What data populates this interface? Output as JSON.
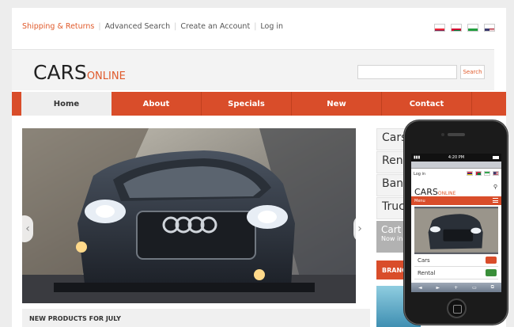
{
  "toplinks": {
    "shipping": "Shipping & Returns",
    "advanced_search": "Advanced Search",
    "create_account": "Create an Account",
    "login": "Log in"
  },
  "flags": [
    "mauritius-flag",
    "maldives-flag",
    "iran-flag",
    "usa-flag"
  ],
  "logo": {
    "main": "CARS",
    "sub": "ONLINE"
  },
  "search": {
    "button": "Search",
    "placeholder": ""
  },
  "nav": [
    "Home",
    "About",
    "Specials",
    "New",
    "Contact"
  ],
  "slider": {
    "prev_icon": "‹",
    "next_icon": "›"
  },
  "section_title": "NEW PRODUCTS FOR JULY",
  "sidebar": {
    "items": [
      "Cars",
      "Rent",
      "Bani",
      "Truc"
    ]
  },
  "cart": {
    "title": "Cart",
    "text": "Now in"
  },
  "branch": "BRANC",
  "phone": {
    "time": "4:20 PM",
    "login": "Log in",
    "logo_main": "CARS",
    "logo_sub": "ONLINE",
    "menu": "Menu",
    "rows": [
      "Cars",
      "Rental"
    ],
    "toolbar": [
      "◄",
      "►",
      "+",
      "▭",
      "⧉"
    ]
  },
  "colors": {
    "accent": "#d94d2a",
    "link_active": "#e05a2b"
  }
}
